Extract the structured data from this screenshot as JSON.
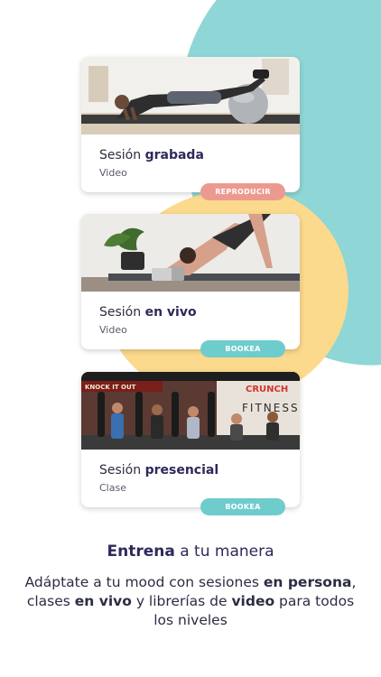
{
  "cards": [
    {
      "title_prefix": "Sesión ",
      "title_bold": "grabada",
      "subtitle": "Video",
      "button_label": "REPRODUCIR",
      "button_color": "#ec9a90"
    },
    {
      "title_prefix": "Sesión ",
      "title_bold": "en vivo",
      "subtitle": "Video",
      "button_label": "BOOKEA",
      "button_color": "#6fcccd"
    },
    {
      "title_prefix": "Sesión ",
      "title_bold": "presencial",
      "subtitle": "Clase",
      "button_label": "BOOKEA",
      "button_color": "#6fcccd",
      "photo_sign": "FITNESS",
      "photo_logo": "CRUNCH",
      "photo_banner": "KNOCK IT OUT"
    }
  ],
  "headline": {
    "bold": "Entrena",
    "rest": " a tu manera"
  },
  "description": {
    "p1": "Adáptate a tu mood con sesiones ",
    "b1": "en persona",
    "p2": ", clases ",
    "b2": "en vivo",
    "p3": " y librerías de ",
    "b3": "video",
    "p4": " para todos los niveles"
  },
  "colors": {
    "teal_blob": "#8fd6d6",
    "yellow_blob": "#fbd98d",
    "title_navy": "#2d2a5a"
  }
}
